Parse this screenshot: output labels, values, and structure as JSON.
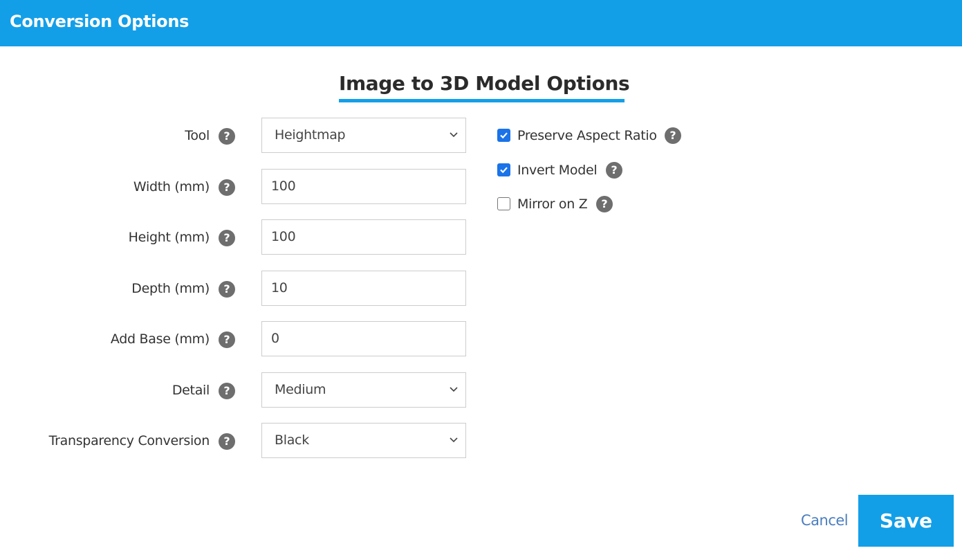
{
  "header": {
    "title": "Conversion Options"
  },
  "section": {
    "title": "Image to 3D Model Options"
  },
  "fields": [
    {
      "label": "Tool",
      "type": "select",
      "value": "Heightmap"
    },
    {
      "label": "Width (mm)",
      "type": "input",
      "value": "100"
    },
    {
      "label": "Height (mm)",
      "type": "input",
      "value": "100"
    },
    {
      "label": "Depth (mm)",
      "type": "input",
      "value": "10"
    },
    {
      "label": "Add Base (mm)",
      "type": "input",
      "value": "0"
    },
    {
      "label": "Detail",
      "type": "select",
      "value": "Medium"
    },
    {
      "label": "Transparency Conversion",
      "type": "select",
      "value": "Black"
    }
  ],
  "checkboxes": [
    {
      "label": "Preserve Aspect Ratio",
      "checked": true
    },
    {
      "label": "Invert Model",
      "checked": true
    },
    {
      "label": "Mirror on Z",
      "checked": false
    }
  ],
  "help_glyph": "?",
  "footer": {
    "cancel_label": "Cancel",
    "save_label": "Save"
  },
  "colors": {
    "accent": "#139fe8",
    "checkbox": "#1a73e8",
    "link": "#4a7ebf",
    "help_icon": "#6e6e6e"
  }
}
